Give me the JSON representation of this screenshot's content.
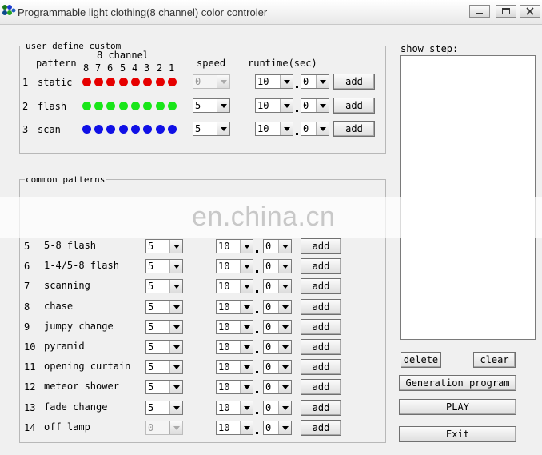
{
  "window": {
    "title": "Programmable light clothing(8 channel) color controler",
    "icon": "colored-dots-app-icon"
  },
  "user_custom": {
    "legend": "user define custom",
    "channel_header": "8 channel",
    "pattern_header": "pattern",
    "speed_header": "speed",
    "runtime_header": "runtime(sec)",
    "channel_numbers": [
      "8",
      "7",
      "6",
      "5",
      "4",
      "3",
      "2",
      "1"
    ],
    "rows": [
      {
        "num": "1",
        "name": "static",
        "color": "#e60000",
        "speed": "0",
        "speed_disabled": true,
        "runtime": "10",
        "runtime_dec": "0",
        "add": "add"
      },
      {
        "num": "2",
        "name": "flash",
        "color": "#19e619",
        "speed": "5",
        "speed_disabled": false,
        "runtime": "10",
        "runtime_dec": "0",
        "add": "add"
      },
      {
        "num": "3",
        "name": "scan",
        "color": "#1010e6",
        "speed": "5",
        "speed_disabled": false,
        "runtime": "10",
        "runtime_dec": "0",
        "add": "add"
      }
    ]
  },
  "common": {
    "legend": "common patterns",
    "rows": [
      {
        "num": "5",
        "name": "5-8 flash",
        "speed": "5",
        "speed_disabled": false,
        "runtime": "10",
        "runtime_dec": "0",
        "add": "add"
      },
      {
        "num": "6",
        "name": "1-4/5-8 flash",
        "speed": "5",
        "speed_disabled": false,
        "runtime": "10",
        "runtime_dec": "0",
        "add": "add"
      },
      {
        "num": "7",
        "name": "scanning",
        "speed": "5",
        "speed_disabled": false,
        "runtime": "10",
        "runtime_dec": "0",
        "add": "add"
      },
      {
        "num": "8",
        "name": "chase",
        "speed": "5",
        "speed_disabled": false,
        "runtime": "10",
        "runtime_dec": "0",
        "add": "add"
      },
      {
        "num": "9",
        "name": "jumpy change",
        "speed": "5",
        "speed_disabled": false,
        "runtime": "10",
        "runtime_dec": "0",
        "add": "add"
      },
      {
        "num": "10",
        "name": "pyramid",
        "speed": "5",
        "speed_disabled": false,
        "runtime": "10",
        "runtime_dec": "0",
        "add": "add"
      },
      {
        "num": "11",
        "name": "opening curtain",
        "speed": "5",
        "speed_disabled": false,
        "runtime": "10",
        "runtime_dec": "0",
        "add": "add"
      },
      {
        "num": "12",
        "name": "meteor shower",
        "speed": "5",
        "speed_disabled": false,
        "runtime": "10",
        "runtime_dec": "0",
        "add": "add"
      },
      {
        "num": "13",
        "name": "fade change",
        "speed": "5",
        "speed_disabled": false,
        "runtime": "10",
        "runtime_dec": "0",
        "add": "add"
      },
      {
        "num": "14",
        "name": "off lamp",
        "speed": "0",
        "speed_disabled": true,
        "runtime": "10",
        "runtime_dec": "0",
        "add": "add"
      }
    ]
  },
  "side": {
    "show_step_label": "show step:",
    "delete": "delete",
    "clear": "clear",
    "generate": "Generation program",
    "play": "PLAY",
    "exit": "Exit"
  },
  "watermark": "en.china.cn"
}
